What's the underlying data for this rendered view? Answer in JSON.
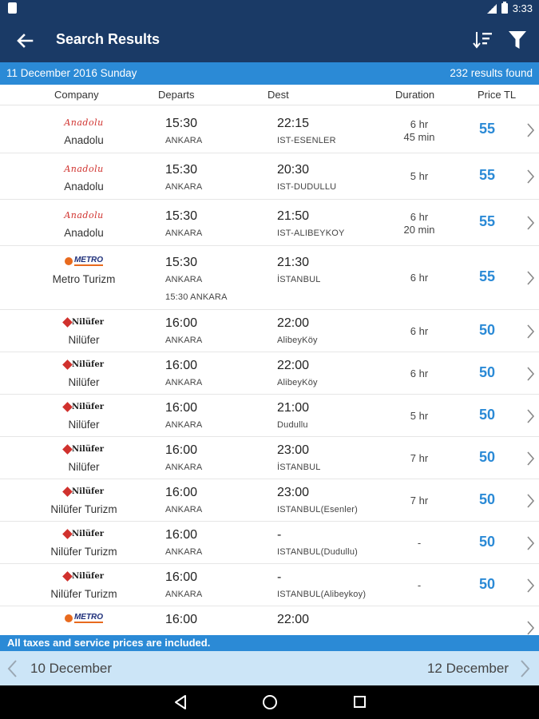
{
  "status_bar": {
    "time": "3:33"
  },
  "appbar": {
    "title": "Search Results",
    "back_icon": "arrow-left-icon",
    "sort_icon": "sort-icon",
    "filter_icon": "filter-icon"
  },
  "datebar": {
    "date": "11 December 2016 Sunday",
    "results": "232 results found"
  },
  "columns": {
    "company": "Company",
    "departs": "Departs",
    "dest": "Dest",
    "duration": "Duration",
    "price": "Price TL"
  },
  "rows": [
    {
      "logo": "anadolu",
      "logo_text": "Anadolu",
      "company": "Anadolu",
      "dep_time": "15:30",
      "dep_place": "ANKARA",
      "dep_extra": "",
      "arr_time": "22:15",
      "arr_place": "IST-ESENLER",
      "dur1": "6 hr",
      "dur2": "45 min",
      "price": "55"
    },
    {
      "logo": "anadolu",
      "logo_text": "Anadolu",
      "company": "Anadolu",
      "dep_time": "15:30",
      "dep_place": "ANKARA",
      "dep_extra": "",
      "arr_time": "20:30",
      "arr_place": "IST-DUDULLU",
      "dur1": "5 hr",
      "dur2": "",
      "price": "55"
    },
    {
      "logo": "anadolu",
      "logo_text": "Anadolu",
      "company": "Anadolu",
      "dep_time": "15:30",
      "dep_place": "ANKARA",
      "dep_extra": "",
      "arr_time": "21:50",
      "arr_place": "IST-ALIBEYKOY",
      "dur1": "6 hr",
      "dur2": "20 min",
      "price": "55"
    },
    {
      "logo": "metro",
      "logo_text": "METRO",
      "company": "Metro Turizm",
      "dep_time": "15:30",
      "dep_place": "ANKARA",
      "dep_extra": "15:30 ANKARA",
      "arr_time": "21:30",
      "arr_place": "İSTANBUL",
      "dur1": "6 hr",
      "dur2": "",
      "price": "55"
    },
    {
      "logo": "nilufer",
      "logo_text": "Nilüfer",
      "company": "Nilüfer",
      "dep_time": "16:00",
      "dep_place": "ANKARA",
      "dep_extra": "",
      "arr_time": "22:00",
      "arr_place": "AlibeyKöy",
      "dur1": "6 hr",
      "dur2": "",
      "price": "50"
    },
    {
      "logo": "nilufer",
      "logo_text": "Nilüfer",
      "company": "Nilüfer",
      "dep_time": "16:00",
      "dep_place": "ANKARA",
      "dep_extra": "",
      "arr_time": "22:00",
      "arr_place": "AlibeyKöy",
      "dur1": "6 hr",
      "dur2": "",
      "price": "50"
    },
    {
      "logo": "nilufer",
      "logo_text": "Nilüfer",
      "company": "Nilüfer",
      "dep_time": "16:00",
      "dep_place": "ANKARA",
      "dep_extra": "",
      "arr_time": "21:00",
      "arr_place": "Dudullu",
      "dur1": "5 hr",
      "dur2": "",
      "price": "50"
    },
    {
      "logo": "nilufer",
      "logo_text": "Nilüfer",
      "company": "Nilüfer",
      "dep_time": "16:00",
      "dep_place": "ANKARA",
      "dep_extra": "",
      "arr_time": "23:00",
      "arr_place": "İSTANBUL",
      "dur1": "7 hr",
      "dur2": "",
      "price": "50"
    },
    {
      "logo": "nilufer",
      "logo_text": "Nilüfer",
      "company": "Nilüfer Turizm",
      "dep_time": "16:00",
      "dep_place": "ANKARA",
      "dep_extra": "",
      "arr_time": "23:00",
      "arr_place": "ISTANBUL(Esenler)",
      "dur1": "7 hr",
      "dur2": "",
      "price": "50"
    },
    {
      "logo": "nilufer",
      "logo_text": "Nilüfer",
      "company": "Nilüfer Turizm",
      "dep_time": "16:00",
      "dep_place": "ANKARA",
      "dep_extra": "",
      "arr_time": "-",
      "arr_place": "ISTANBUL(Dudullu)",
      "dur1": "-",
      "dur2": "",
      "price": "50"
    },
    {
      "logo": "nilufer",
      "logo_text": "Nilüfer",
      "company": "Nilüfer Turizm",
      "dep_time": "16:00",
      "dep_place": "ANKARA",
      "dep_extra": "",
      "arr_time": "-",
      "arr_place": "ISTANBUL(Alibeykoy)",
      "dur1": "-",
      "dur2": "",
      "price": "50"
    },
    {
      "logo": "metro",
      "logo_text": "METRO",
      "company": "",
      "dep_time": "16:00",
      "dep_place": "",
      "dep_extra": "",
      "arr_time": "22:00",
      "arr_place": "",
      "dur1": "",
      "dur2": "",
      "price": ""
    }
  ],
  "footnote": "All taxes and service prices are included.",
  "date_nav": {
    "prev": "10 December",
    "next": "12 December"
  },
  "colors": {
    "appbar": "#1a3a66",
    "accent": "#2b8ad6",
    "nav_bg": "#cce5f7",
    "price": "#2b8ad6"
  }
}
